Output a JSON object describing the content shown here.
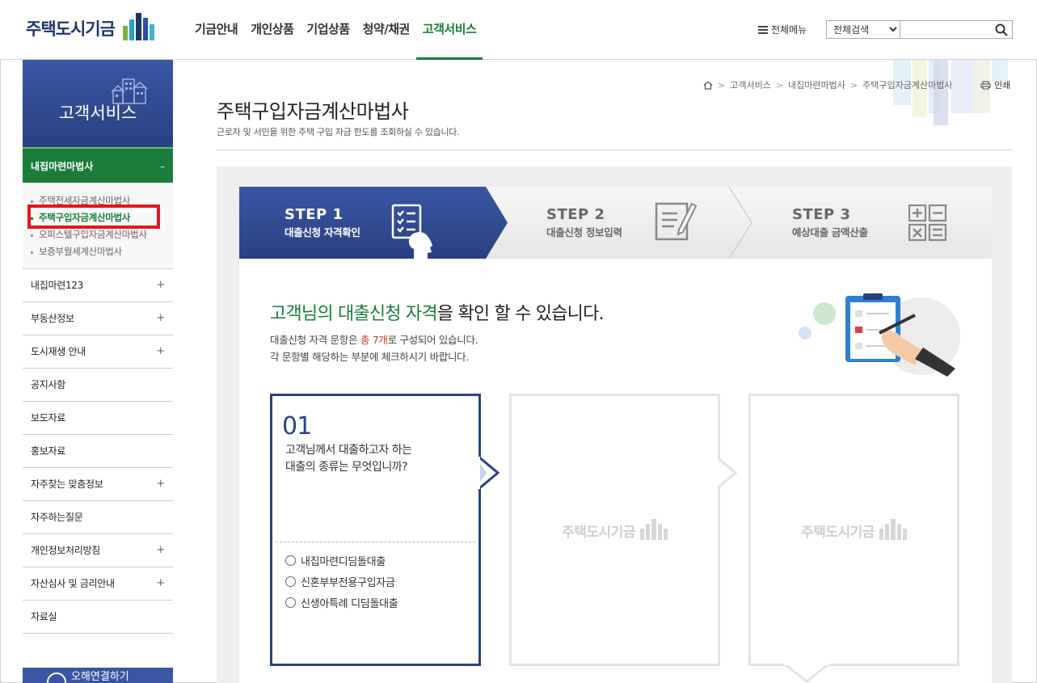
{
  "header": {
    "logo_text": "주택도시기금",
    "nav": [
      "기금안내",
      "개인상품",
      "기업상품",
      "청약/채권",
      "고객서비스"
    ],
    "active_nav": "고객서비스",
    "all_menu": "전체메뉴",
    "search_select": "전체검색",
    "search_icon": "search-icon"
  },
  "sidebar": {
    "title": "고객서비스",
    "active_section": "내집마련마법사",
    "active_toggle": "–",
    "sub_items": [
      "주택전세자금계산마법사",
      "주택구입자금계산마법사",
      "오피스텔구입자금계산마법사",
      "보증부월세계산마법사"
    ],
    "selected_sub": "주택구입자금계산마법사",
    "items": [
      {
        "label": "내집마련123",
        "toggle": "+"
      },
      {
        "label": "부동산정보",
        "toggle": "+"
      },
      {
        "label": "도시재생 안내",
        "toggle": "+"
      },
      {
        "label": "공지사항",
        "toggle": ""
      },
      {
        "label": "보도자료",
        "toggle": ""
      },
      {
        "label": "홍보자료",
        "toggle": ""
      },
      {
        "label": "자주찾는 맞춤정보",
        "toggle": "+"
      },
      {
        "label": "자주하는질문",
        "toggle": ""
      },
      {
        "label": "개인정보처리방침",
        "toggle": "+"
      },
      {
        "label": "자산심사 및 금리안내",
        "toggle": "+"
      },
      {
        "label": "자료실",
        "toggle": ""
      }
    ],
    "banner": "오해연결하기"
  },
  "breadcrumb": {
    "items": [
      "고객서비스",
      "내집마련마법사",
      "주택구입자금계산마법사"
    ],
    "print": "인쇄"
  },
  "page": {
    "title": "주택구입자금계산마법사",
    "description": "근로자 및 서민을 위한 주택 구입 자금 한도를 조회하실 수 있습니다."
  },
  "steps": [
    {
      "num": "STEP 1",
      "label": "대출신청 자격확인",
      "icon": "checklist-person-icon"
    },
    {
      "num": "STEP 2",
      "label": "대출신청 정보입력",
      "icon": "document-pen-icon"
    },
    {
      "num": "STEP 3",
      "label": "예상대출 금액산출",
      "icon": "calculator-icon"
    }
  ],
  "intro": {
    "title_green1": "고객님의 ",
    "title_green2": "대출신청 자격",
    "title_rest": "을 확인 할 수 있습니다.",
    "desc1_pre": "대출신청 자격 문항은 ",
    "desc1_red": "총 7개",
    "desc1_post": "로 구성되어 있습니다.",
    "desc2": "각 문항별 해당하는 부분에 체크하시기 바랍니다."
  },
  "question": {
    "number": "01",
    "text_line1": "고객님께서 대출하고자 하는",
    "text_line2": "대출의 종류는 무엇입니까?",
    "options": [
      "내집마련디딤돌대출",
      "신혼부부전용구입자금",
      "신생아특례 디딤돌대출"
    ]
  },
  "placeholder_logo": "주택도시기금",
  "colors": {
    "brand_blue": "#2a4380",
    "brand_green": "#16803a",
    "highlight_red": "#e8141e"
  }
}
